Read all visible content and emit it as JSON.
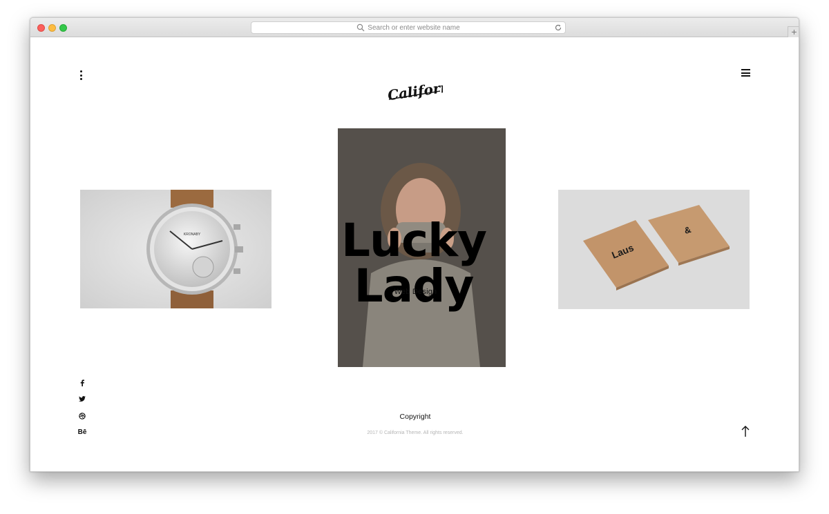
{
  "browser": {
    "url_placeholder": "Search or enter website name",
    "new_tab_label": "+"
  },
  "header": {
    "logo_text": "California"
  },
  "hero": {
    "title": "Lucky Lady",
    "subtitle": "Web Design"
  },
  "slides": [
    {
      "name": "watch",
      "caption": "KRONABY"
    },
    {
      "name": "model-sweater"
    },
    {
      "name": "boxes",
      "labels": [
        "Laus",
        "&"
      ]
    }
  ],
  "social": {
    "behance_label": "Bē"
  },
  "footer": {
    "copyright_title": "Copyright",
    "copyright_note": "2017 © California Theme. All rights reserved."
  },
  "colors": {
    "accent": "#000000",
    "muted": "#b5b5b5",
    "card_left_bg": "#d9d9d9",
    "card_center_bg": "#55504b",
    "card_right_bg": "#dcdcdc"
  }
}
